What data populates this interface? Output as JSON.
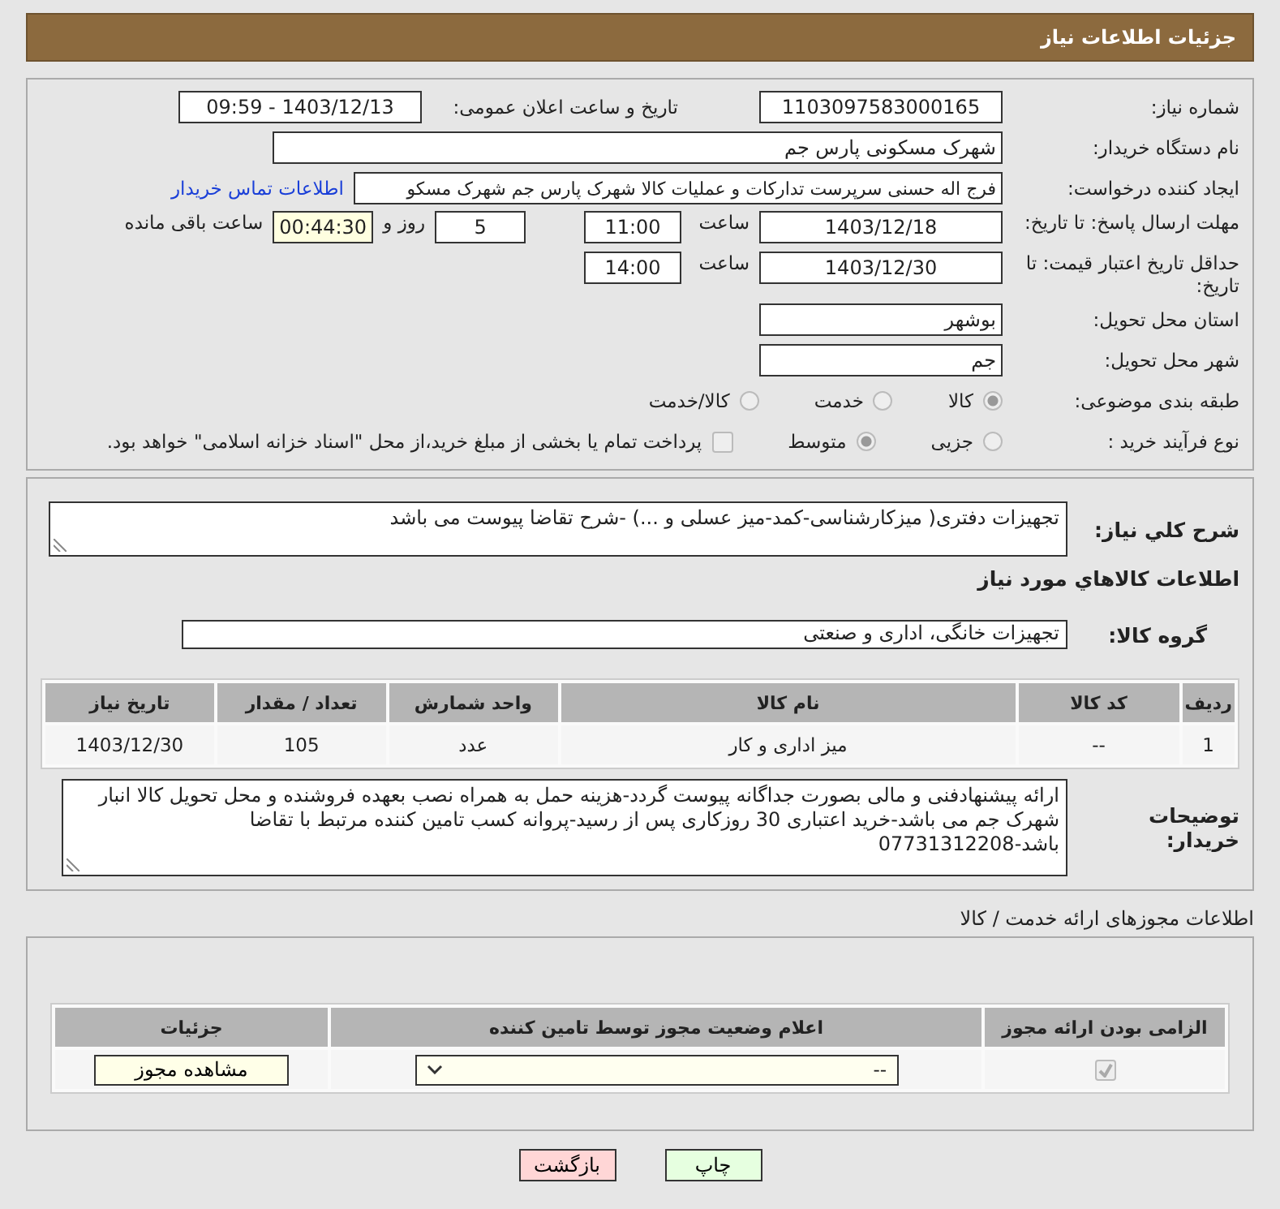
{
  "header": {
    "title": "جزئیات اطلاعات نیاز"
  },
  "need_number": {
    "label": "شماره نیاز:",
    "value": "1103097583000165"
  },
  "announce": {
    "label": "تاریخ و ساعت اعلان عمومی:",
    "value": "1403/12/13 - 09:59"
  },
  "buyer": {
    "label": "نام دستگاه خریدار:",
    "value": "شهرک مسکونی پارس جم"
  },
  "creator": {
    "label": "ایجاد کننده درخواست:",
    "value": "فرج اله حسنی سرپرست تدارکات و عملیات کالا شهرک پارس جم شهرک مسکو",
    "link": "اطلاعات تماس خریدار"
  },
  "deadline": {
    "label": "مهلت ارسال پاسخ: تا تاریخ:",
    "date": "1403/12/18",
    "time_label": "ساعت",
    "time": "11:00",
    "days": "5",
    "days_label": "روز و",
    "remaining": "00:44:30",
    "remaining_label": "ساعت باقی مانده"
  },
  "validity": {
    "label": "حداقل تاریخ اعتبار قیمت: تا تاریخ:",
    "date": "1403/12/30",
    "time_label": "ساعت",
    "time": "14:00"
  },
  "province": {
    "label": "استان محل تحویل:",
    "value": "بوشهر"
  },
  "city": {
    "label": "شهر محل تحویل:",
    "value": "جم"
  },
  "category": {
    "label": "طبقه بندی موضوعی:",
    "options": [
      {
        "label": "کالا",
        "selected": true
      },
      {
        "label": "خدمت",
        "selected": false
      },
      {
        "label": "کالا/خدمت",
        "selected": false
      }
    ]
  },
  "process": {
    "label": "نوع فرآیند خرید :",
    "options": [
      {
        "label": "جزیی",
        "selected": false
      },
      {
        "label": "متوسط",
        "selected": true
      }
    ],
    "payment": {
      "checked": false,
      "text": "پرداخت تمام یا بخشی از مبلغ خرید،از محل \"اسناد خزانه اسلامی\" خواهد بود."
    }
  },
  "description": {
    "label": "شرح كلي نياز:",
    "value": "تجهیزات دفتری( میزکارشناسی-کمد-میز عسلی و ...) -شرح تقاضا پیوست می باشد"
  },
  "goods_title": "اطلاعات كالاهاي مورد نياز",
  "group": {
    "label": "گروه کالا:",
    "value": "تجهیزات خانگی، اداری و صنعتی"
  },
  "table": {
    "columns": [
      "ردیف",
      "کد کالا",
      "نام کالا",
      "واحد شمارش",
      "تعداد / مقدار",
      "تاریخ نیاز"
    ],
    "rows": [
      [
        "1",
        "--",
        "میز اداری و کار",
        "عدد",
        "105",
        "1403/12/30"
      ]
    ]
  },
  "buyer_notes": {
    "label": "توضیحات خریدار:",
    "value": "ارائه پیشنهادفنی و مالی بصورت جداگانه پیوست گردد-هزینه حمل به همراه نصب  بعهده فروشنده و محل تحویل کالا انبار شهرک جم می باشد-خرید اعتباری 30 روزکاری پس از رسید-پروانه کسب تامین کننده مرتبط با تقاضا باشد-07731312208"
  },
  "licenses": {
    "title": "اطلاعات مجوزهای ارائه خدمت / کالا",
    "columns": [
      "الزامی بودن ارائه مجوز",
      "اعلام وضعیت مجوز توسط تامین کننده",
      "جزئیات"
    ],
    "rows": [
      {
        "required": true,
        "status": "--",
        "action": "مشاهده مجوز"
      }
    ]
  },
  "buttons": [
    {
      "label": "چاپ",
      "kind": "print"
    },
    {
      "label": "بازگشت",
      "kind": "back"
    }
  ]
}
